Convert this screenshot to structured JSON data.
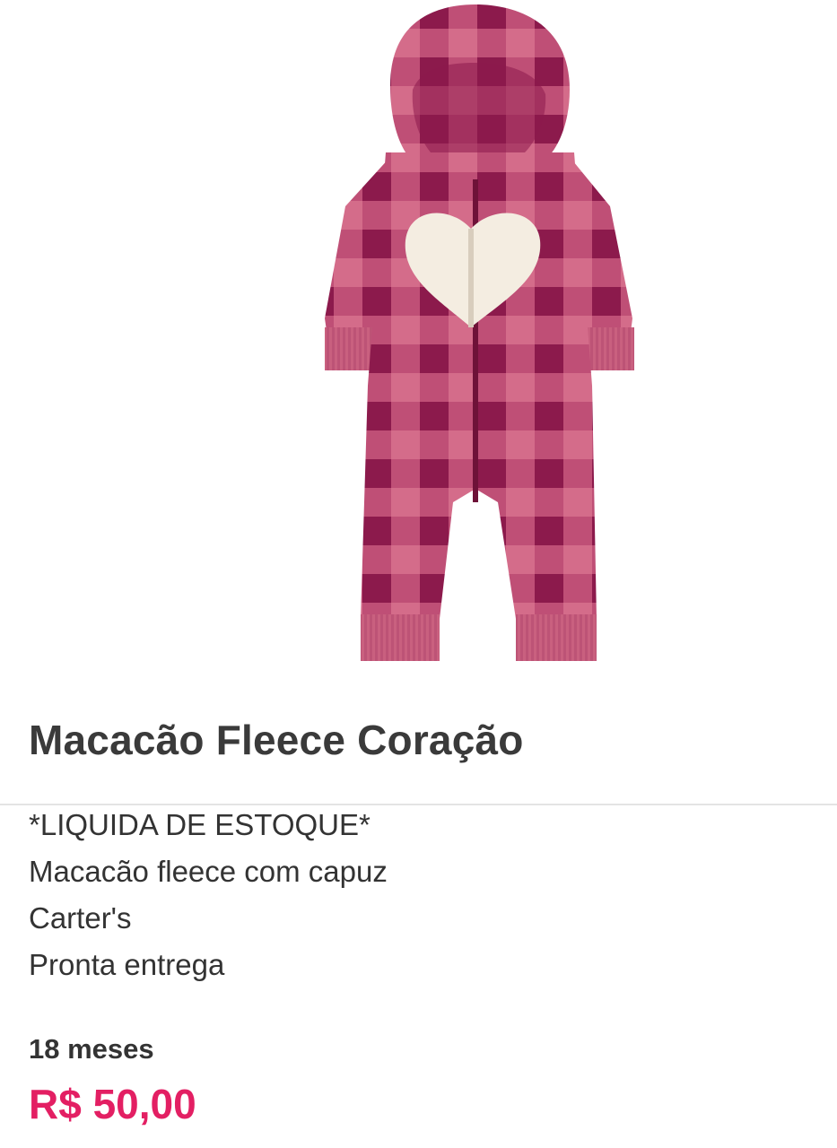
{
  "product": {
    "image_alt": "Macacão fleece xadrez rosa com capuz e coração",
    "title": "Macacão Fleece Coração",
    "description_lines": [
      "*LIQUIDA DE ESTOQUE*",
      "Macacão fleece com capuz",
      "Carter's",
      "Pronta entrega"
    ],
    "size": "18 meses",
    "price": "R$ 50,00"
  },
  "colors": {
    "price": "#e31f63",
    "plaid_dark": "#8e1d4f",
    "plaid_light": "#d36a88",
    "heart": "#f3ece0"
  }
}
